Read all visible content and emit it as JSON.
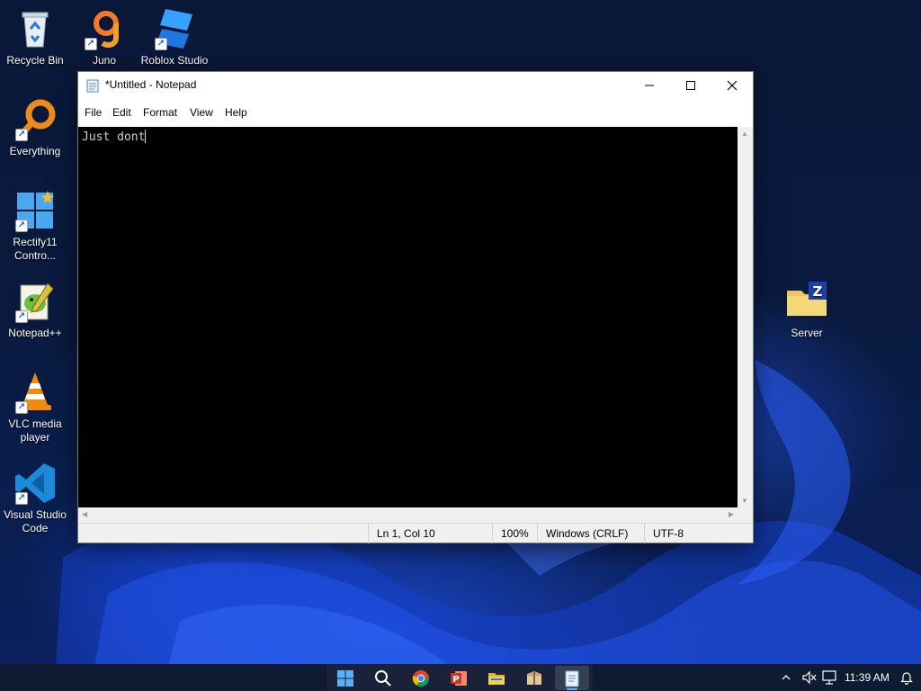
{
  "desktop": {
    "icons": [
      {
        "label": "Recycle Bin",
        "icon": "recycle-bin-icon"
      },
      {
        "label": "Juno",
        "icon": "juno-icon"
      },
      {
        "label": "Roblox Studio",
        "icon": "roblox-studio-icon"
      },
      {
        "label": "Everything",
        "icon": "everything-search-icon"
      },
      {
        "label": "Rectify11 Contro...",
        "icon": "rectify11-control-icon"
      },
      {
        "label": "Notepad++",
        "icon": "notepadpp-icon"
      },
      {
        "label": "VLC media player",
        "icon": "vlc-icon"
      },
      {
        "label": "Visual Studio Code",
        "icon": "vscode-icon"
      },
      {
        "label": "Server",
        "icon": "zipped-folder-icon"
      }
    ]
  },
  "notepad": {
    "title": "*Untitled - Notepad",
    "menu": [
      "File",
      "Edit",
      "Format",
      "View",
      "Help"
    ],
    "content": "Just dont",
    "status": {
      "position": "Ln 1, Col 10",
      "zoom": "100%",
      "line_ending": "Windows (CRLF)",
      "encoding": "UTF-8"
    },
    "editor_background": "#000000"
  },
  "taskbar": {
    "apps": [
      "start-icon",
      "search-icon",
      "chrome-icon",
      "powerpoint-icon",
      "file-explorer-icon",
      "archive-icon",
      "notepad-icon"
    ],
    "tray": {
      "time": "11:39 AM"
    },
    "accent": "#6cb4ff"
  }
}
